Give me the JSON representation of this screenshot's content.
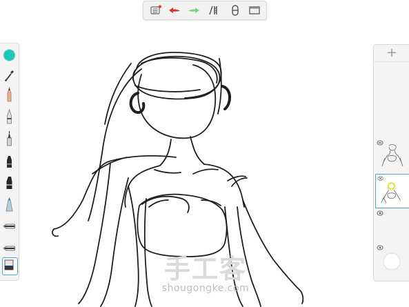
{
  "colors": {
    "current_color": "#1cc9b8",
    "panel_bg": "#f4f4f4",
    "selection": "#4aa3e0",
    "stroke": "#1e1e1e",
    "undo": "#d9342b",
    "redo": "#7dd37d"
  },
  "top_toolbar": {
    "buttons": [
      {
        "name": "menu-list-icon"
      },
      {
        "name": "undo-arrow-icon"
      },
      {
        "name": "redo-arrow-icon"
      },
      {
        "name": "ruler-perspective-icon"
      },
      {
        "name": "symmetry-icon"
      },
      {
        "name": "canvas-frame-icon"
      }
    ]
  },
  "left_tools": [
    {
      "name": "color-puck-icon"
    },
    {
      "name": "eyedropper-icon"
    },
    {
      "name": "pencil-tool-icon"
    },
    {
      "name": "ballpoint-pen-icon"
    },
    {
      "name": "fineliner-icon"
    },
    {
      "name": "marker-icon"
    },
    {
      "name": "chisel-marker-icon"
    },
    {
      "name": "airbrush-icon"
    },
    {
      "name": "brush-flat-icon"
    },
    {
      "name": "smear-brush-icon"
    },
    {
      "name": "eraser-icon"
    }
  ],
  "layers_panel": {
    "add_label": "+",
    "layers": [
      {
        "name": "layer-sketch",
        "visible": true
      },
      {
        "name": "layer-active",
        "visible": false
      },
      {
        "name": "layer-empty",
        "visible": true
      },
      {
        "name": "layer-background",
        "visible": true
      }
    ]
  },
  "watermark": {
    "title": "手工客",
    "url": "shougongke.com"
  }
}
